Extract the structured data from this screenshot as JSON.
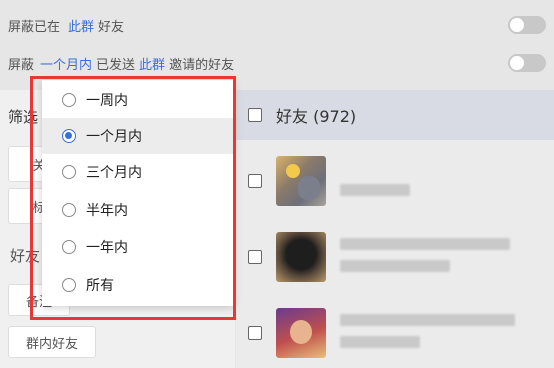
{
  "settings": {
    "row1": {
      "prefix": "屏蔽已在",
      "link": "此群",
      "suffix": "好友"
    },
    "row2": {
      "prefix": "屏蔽",
      "link_period": "一个月内",
      "middle": "已发送",
      "link_group": "此群",
      "suffix": "邀请的好友"
    }
  },
  "filter": {
    "header": "筛选",
    "chip1": "关",
    "chip2": "标",
    "friends_label": "好友",
    "chip3": "备注",
    "chip4": "群内好友"
  },
  "list": {
    "title": "好友 (972)"
  },
  "popup": {
    "options": [
      "一周内",
      "一个月内",
      "三个月内",
      "半年内",
      "一年内",
      "所有"
    ],
    "selected": "一个月内"
  },
  "colors": {
    "accent": "#3b6fd8",
    "highlight_border": "#e53935"
  }
}
